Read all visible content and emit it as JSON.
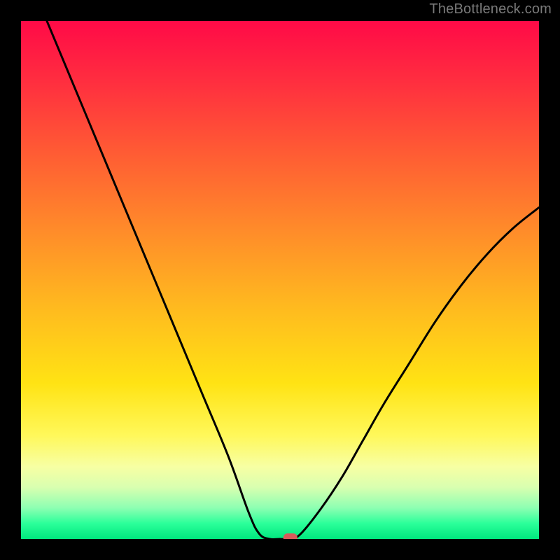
{
  "watermark": "TheBottleneck.com",
  "chart_data": {
    "type": "line",
    "title": "",
    "xlabel": "",
    "ylabel": "",
    "xlim": [
      0,
      100
    ],
    "ylim": [
      0,
      100
    ],
    "grid": false,
    "legend": false,
    "curve_points": [
      {
        "x": 5,
        "y": 100
      },
      {
        "x": 10,
        "y": 88
      },
      {
        "x": 15,
        "y": 76
      },
      {
        "x": 20,
        "y": 64
      },
      {
        "x": 25,
        "y": 52
      },
      {
        "x": 30,
        "y": 40
      },
      {
        "x": 35,
        "y": 28
      },
      {
        "x": 40,
        "y": 16
      },
      {
        "x": 44,
        "y": 5
      },
      {
        "x": 46,
        "y": 1
      },
      {
        "x": 48,
        "y": 0
      },
      {
        "x": 50,
        "y": 0
      },
      {
        "x": 52,
        "y": 0
      },
      {
        "x": 54,
        "y": 1
      },
      {
        "x": 58,
        "y": 6
      },
      {
        "x": 62,
        "y": 12
      },
      {
        "x": 66,
        "y": 19
      },
      {
        "x": 70,
        "y": 26
      },
      {
        "x": 75,
        "y": 34
      },
      {
        "x": 80,
        "y": 42
      },
      {
        "x": 85,
        "y": 49
      },
      {
        "x": 90,
        "y": 55
      },
      {
        "x": 95,
        "y": 60
      },
      {
        "x": 100,
        "y": 64
      }
    ],
    "marker": {
      "x": 52,
      "y": 0
    },
    "colors": {
      "curve": "#000000",
      "marker": "#d85a5a",
      "gradient_top": "#ff0a47",
      "gradient_bottom": "#00e77e"
    }
  }
}
